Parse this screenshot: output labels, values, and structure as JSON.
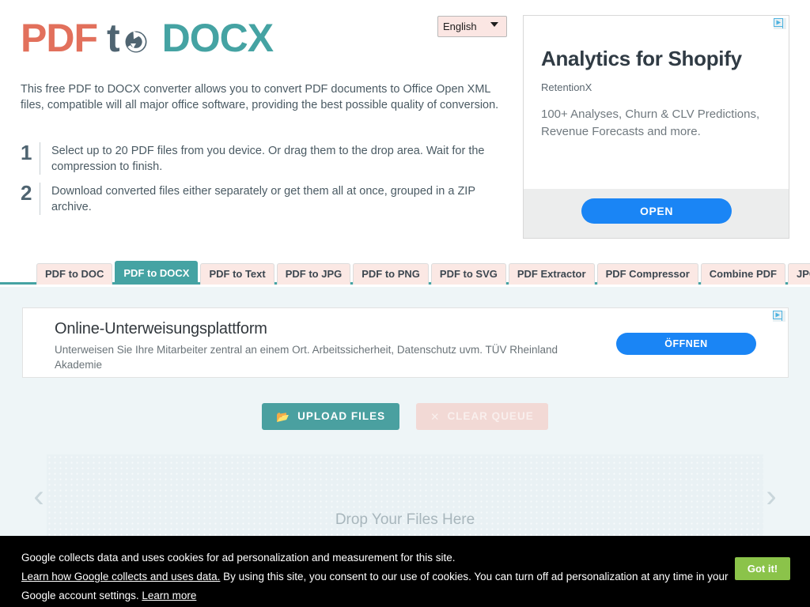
{
  "site": {
    "logo": {
      "part1": "PDF",
      "part2": "t",
      "refresh_icon": "refresh-circle-icon",
      "part3": "DOCX"
    }
  },
  "language": {
    "selected": "English",
    "chevron_icon": "chevron-down-icon"
  },
  "intro": {
    "paragraph": "This free PDF to DOCX converter allows you to convert PDF documents to Office Open XML files, compatible will all major office software, providing the best possible quality of conversion."
  },
  "steps": [
    {
      "number": "1",
      "text": "Select up to 20 PDF files from you device. Or drag them to the drop area. Wait for the compression to finish."
    },
    {
      "number": "2",
      "text": "Download converted files either separately or get them all at once, grouped in a ZIP archive."
    }
  ],
  "sidebar_ad": {
    "adchoices_icon": "adchoices-icon",
    "title": "Analytics for Shopify",
    "brand": "RetentionX",
    "description": "100+ Analyses, Churn & CLV Predictions, Revenue Forecasts and more.",
    "button_label": "OPEN"
  },
  "tabs": [
    {
      "label": "PDF to DOC",
      "active": false
    },
    {
      "label": "PDF to DOCX",
      "active": true
    },
    {
      "label": "PDF to Text",
      "active": false
    },
    {
      "label": "PDF to JPG",
      "active": false
    },
    {
      "label": "PDF to PNG",
      "active": false
    },
    {
      "label": "PDF to SVG",
      "active": false
    },
    {
      "label": "PDF Extractor",
      "active": false
    },
    {
      "label": "PDF Compressor",
      "active": false
    },
    {
      "label": "Combine PDF",
      "active": false
    },
    {
      "label": "JPG to PDF",
      "active": false
    }
  ],
  "banner_ad": {
    "adchoices_icon": "adchoices-icon",
    "title": "Online-Unterweisungsplattform",
    "description": "Unterweisen Sie Ihre Mitarbeiter zentral an einem Ort. Arbeitssicherheit, Datenschutz uvm. TÜV Rheinland Akademie",
    "button_label": "ÖFFNEN"
  },
  "actions": {
    "upload_icon": "folder-open-icon",
    "upload_label": "UPLOAD FILES",
    "clear_icon": "close-x-icon",
    "clear_label": "CLEAR QUEUE"
  },
  "dropzone": {
    "label": "Drop Your Files Here",
    "prev_icon": "chevron-left-icon",
    "prev_glyph": "‹",
    "next_icon": "chevron-right-icon",
    "next_glyph": "›"
  },
  "cookie": {
    "line1": "Google collects data and uses cookies for ad personalization and measurement for this site.",
    "link1": "Learn how Google collects and uses data.",
    "body": " By using this site, you consent to our use of cookies. You can turn off ad personalization at any time in your Google account settings. ",
    "link2": "Learn more",
    "button_label": "Got it!"
  },
  "colors": {
    "salmon": "#e2705c",
    "slate": "#4f6471",
    "teal": "#45a3a3",
    "tab_pink": "#fbe8e4",
    "ad_blue": "#1a85f5",
    "cookie_green": "#8bc34a",
    "workspace_bg": "#eef5f7"
  }
}
